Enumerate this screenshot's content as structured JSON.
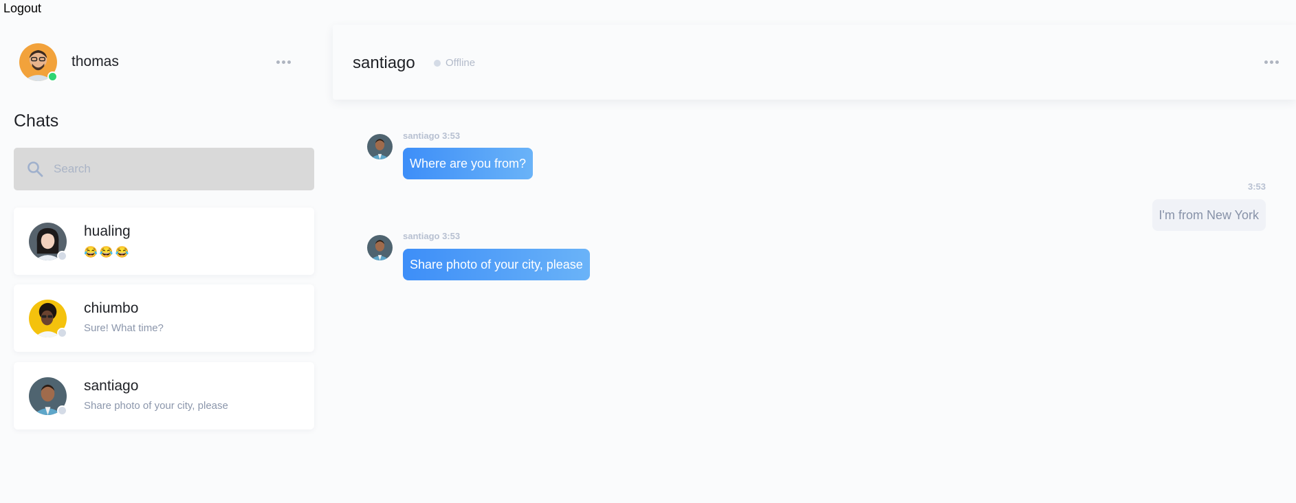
{
  "top": {
    "logout_label": "Logout"
  },
  "me": {
    "name": "thomas",
    "status": "online"
  },
  "sidebar": {
    "title": "Chats",
    "search_placeholder": "Search",
    "chats": [
      {
        "name": "hualing",
        "preview": "😂😂😂",
        "status": "offline"
      },
      {
        "name": "chiumbo",
        "preview": "Sure! What time?",
        "status": "offline"
      },
      {
        "name": "santiago",
        "preview": "Share photo of your city, please",
        "status": "offline"
      }
    ]
  },
  "conversation": {
    "name": "santiago",
    "status": "Offline",
    "messages": [
      {
        "direction": "in",
        "sender": "santiago",
        "time": "3:53",
        "meta": "santiago 3:53",
        "text": "Where are you from?"
      },
      {
        "direction": "out",
        "time": "3:53",
        "meta": "3:53",
        "text": "I'm from New York"
      },
      {
        "direction": "in",
        "sender": "santiago",
        "time": "3:53",
        "meta": "santiago 3:53",
        "text": "Share photo of your city, please"
      }
    ]
  },
  "colors": {
    "accent_gradient_start": "#3d8ef8",
    "accent_gradient_end": "#6ab3f8",
    "online": "#2ed573",
    "offline": "#d4dbe6",
    "outgoing_bubble": "#f0f2f7"
  },
  "icons": {
    "search": "search-icon",
    "more": "more-dots-icon"
  }
}
